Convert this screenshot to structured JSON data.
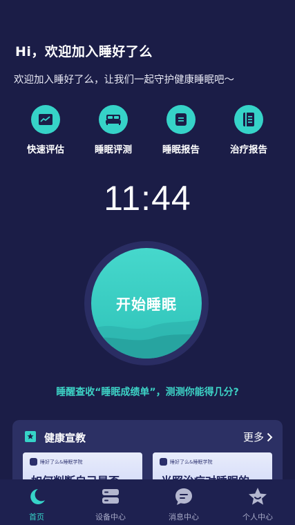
{
  "greeting": {
    "title": "Hi，欢迎加入睡好了么",
    "subtitle": "欢迎加入睡好了么，让我们一起守护健康睡眠吧～"
  },
  "quick_actions": [
    {
      "label": "快速评估",
      "icon": "chart-line-icon"
    },
    {
      "label": "睡眠评测",
      "icon": "bed-icon"
    },
    {
      "label": "睡眠报告",
      "icon": "report-icon"
    },
    {
      "label": "治疗报告",
      "icon": "book-icon"
    }
  ],
  "clock": "11:44",
  "sleep_button": {
    "label": "开始睡眠"
  },
  "promo": "睡醒查收“睡眠成绩单”，测测你能得几分?",
  "education": {
    "title": "健康宣教",
    "more": "更多",
    "articles": [
      {
        "brand": "睡好了么&睡眠学院",
        "headline": "如何判断自己是否"
      },
      {
        "brand": "睡好了么&睡眠学院",
        "headline": "光照治疗对睡眠的"
      }
    ]
  },
  "tabbar": [
    {
      "label": "首页",
      "icon": "moon-icon",
      "active": true
    },
    {
      "label": "设备中心",
      "icon": "device-icon",
      "active": false
    },
    {
      "label": "消息中心",
      "icon": "chat-icon",
      "active": false
    },
    {
      "label": "个人中心",
      "icon": "star-icon",
      "active": false
    }
  ],
  "colors": {
    "background": "#1b1d47",
    "accent": "#36d3c8",
    "card": "#2c3064",
    "tabbar": "#1e2150"
  }
}
